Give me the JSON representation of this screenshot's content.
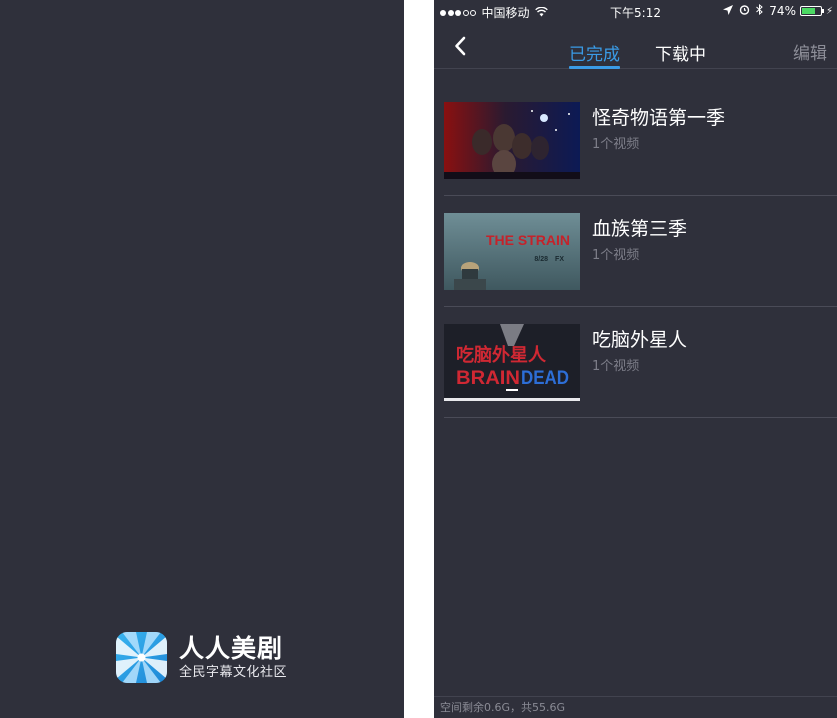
{
  "splash": {
    "app_name": "人人美剧",
    "slogan": "全民字幕文化社区"
  },
  "status_bar": {
    "carrier": "中国移动",
    "time": "下午5:12",
    "battery_percent": "74%",
    "battery_level": 0.74
  },
  "nav": {
    "tabs": [
      {
        "label": "已完成",
        "active": true
      },
      {
        "label": "下载中",
        "active": false
      }
    ],
    "edit_label": "编辑"
  },
  "downloads": [
    {
      "title": "怪奇物语第一季",
      "count": "1个视频"
    },
    {
      "title": "血族第三季",
      "count": "1个视频"
    },
    {
      "title": "吃脑外星人",
      "count": "1个视频"
    }
  ],
  "posters": {
    "strain_title": "THE STRAIN",
    "strain_date": "8/28",
    "strain_network": "FX",
    "braindead_cn": "吃脑外星人",
    "braindead_en_red": "BRAIN",
    "braindead_en_blue": "DEAD"
  },
  "footer": {
    "storage": "空间剩余0.6G，共55.6G"
  },
  "colors": {
    "background": "#2f303b",
    "accent": "#3a9be6",
    "battery": "#4cd964"
  }
}
